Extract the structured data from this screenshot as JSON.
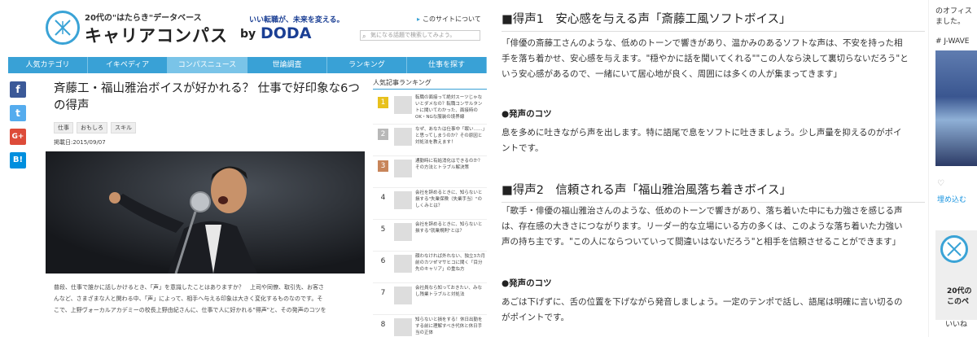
{
  "site": {
    "tagline": "20代の\"はたらき\"データベース",
    "title": "キャリアコンパス",
    "by": "by",
    "brand": "DODA",
    "slogan": "いい転職が、未来を変える。",
    "about_link": "このサイトについて",
    "search_placeholder": "気になる話題で検索してみよう。",
    "nav": [
      "人気カテゴリ",
      "イキペディア",
      "コンパスニュース",
      "世論調査",
      "ランキング",
      "仕事を探す"
    ],
    "nav_active_index": 2,
    "share": [
      "f",
      "t",
      "G+",
      "B!"
    ],
    "article": {
      "title": "斉藤工・福山雅治ボイスが好かれる？ 仕事で好印象な6つの得声",
      "tags": [
        "仕事",
        "おもしろ",
        "スキル"
      ],
      "date": "掲載日:2015/09/07",
      "body": [
        "普段、仕事で誰かに話しかけるとき、「声」を意識したことはありますか？　上司や同僚、取引先、お客さ",
        "んなど、さまざまな人と関わる中、「声」によって、相手へ与える印象は大きく変化するものなのです。そ",
        "こで、上野ヴォーカルアカデミーの校長上野由紀さんに、仕事で人に好かれる\"得声\"と、その発声のコツを"
      ]
    },
    "ranking": {
      "title": "人気記事ランキング",
      "items": [
        {
          "rank": "1",
          "text": "転職の面接って絶対スーツじゃないとダメなの？転職コンサルタントに聞いてわかった、面接時のOK・NGな服装の境界線"
        },
        {
          "rank": "2",
          "text": "なぜ、あなたは仕事中「眠い……」と思ってしまうのか？その原因と対処法を教えます！"
        },
        {
          "rank": "3",
          "text": "通勤時に有給消化はできるのか？ その方法とトラブル解決策"
        },
        {
          "rank": "4",
          "text": "会社を辞めるときに、知らないと損する\"失業保険（失業手当）\"のしくみとは？"
        },
        {
          "rank": "5",
          "text": "会社を辞めるときに、知らないと損する\"就業規則\"とは？"
        },
        {
          "rank": "6",
          "text": "顔わなければ外れない、独立3カ月前のカツぜマサヒコに聞く「目分先のキャリア」の重ね方"
        },
        {
          "rank": "7",
          "text": "会社員なら知っておきたい、みなし残業トラブルと対処法"
        },
        {
          "rank": "8",
          "text": "知らないと損をする！休日出勤をする前に理解すべき代休と休日手当の正体"
        }
      ],
      "rank_colors": [
        "#e8c11c",
        "#b8b8b8",
        "#c8855a"
      ]
    }
  },
  "article2": {
    "h1": "■得声1　安心感を与える声「斎藤工風ソフトボイス」",
    "p1": "「俳優の斎藤工さんのような、低めのトーンで響きがあり、温かみのあるソフトな声は、不安を持った相手を落ち着かせ、安心感を与えます。\"穏やかに話を聞いてくれる\"\"この人なら決して裏切らないだろう\"という安心感があるので、一緒にいて居心地が良く、周囲には多くの人が集まってきます」",
    "tip1_label": "●発声のコツ",
    "tip1": "息を多めに吐きながら声を出します。特に語尾で息をソフトに吐きましょう。少し声量を抑えるのがポイントです。",
    "h2": "■得声2　信頼される声「福山雅治風落ち着きボイス」",
    "p2": "「歌手・俳優の福山雅治さんのような、低めのトーンで響きがあり、落ち着いた中にも力強さを感じる声は、存在感の大きさにつながります。リーダー的な立場にいる方の多くは、このような落ち着いた力強い声の持ち主です。\"この人にならついていって間違いはないだろう\"と相手を信頼させることができます」",
    "tip2_label": "●発声のコツ",
    "tip2": "あごは下げずに、舌の位置を下げながら発音しましょう。一定のテンポで話し、語尾は明確に言い切るのがポイントです。"
  },
  "side": {
    "t1a": "のオフィス",
    "t1b": "ました。",
    "tag": "# J-WAVE",
    "embed": "埋め込む",
    "card1": "20代の",
    "card2": "このペ",
    "like": "いいね"
  }
}
